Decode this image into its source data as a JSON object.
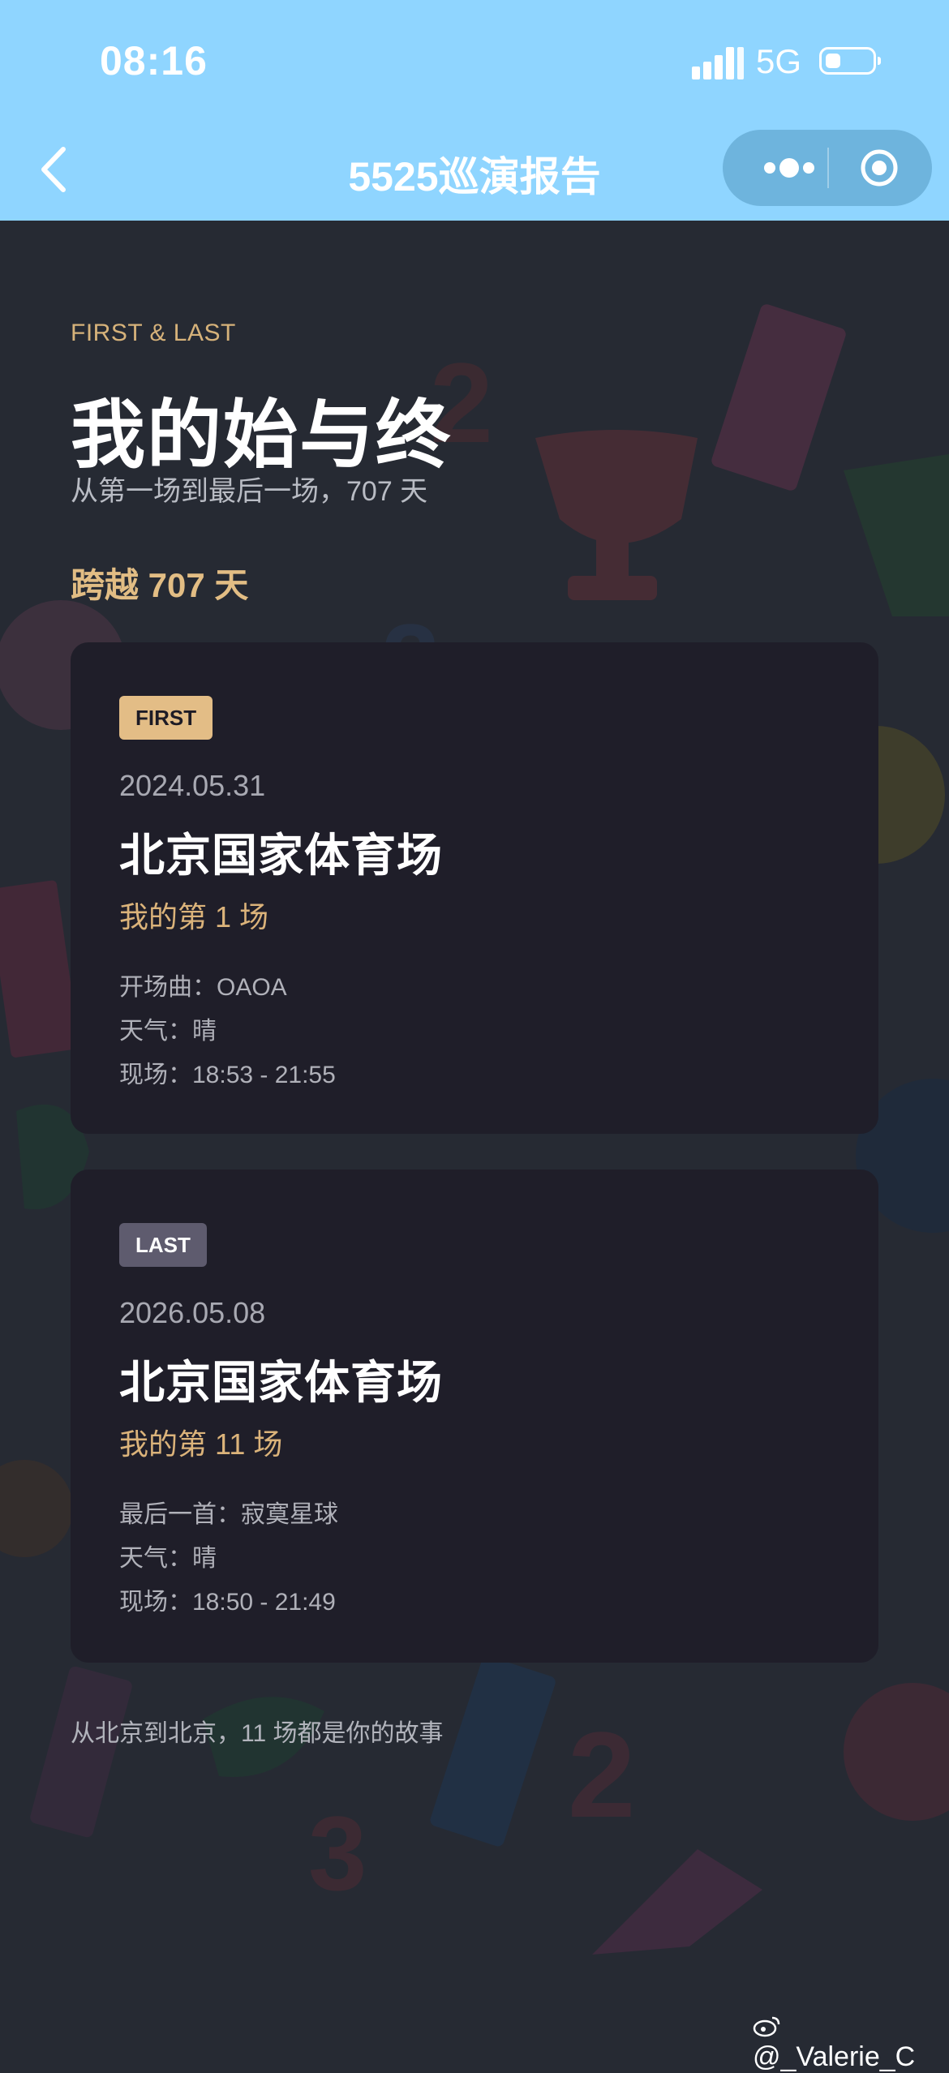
{
  "status_bar": {
    "time": "08:16",
    "network": "5G"
  },
  "nav": {
    "title": "5525巡演报告"
  },
  "report": {
    "eyebrow": "FIRST & LAST",
    "heading": "我的始与终",
    "subheading": "从第一场到最后一场，707 天",
    "span": "跨越 707 天"
  },
  "first_card": {
    "badge": "FIRST",
    "date": "2024.05.31",
    "venue": "北京国家体育场",
    "count": "我的第 1 场",
    "details": [
      "开场曲：OAOA",
      "天气：晴",
      "现场：18:53 - 21:55"
    ]
  },
  "last_card": {
    "badge": "LAST",
    "date": "2026.05.08",
    "venue": "北京国家体育场",
    "count": "我的第 11 场",
    "details": [
      "最后一首：寂寞星球",
      "天气：晴",
      "现场：18:50 - 21:49"
    ]
  },
  "footer": "从北京到北京，11 场都是你的故事",
  "watermark": "@_Valerie_C",
  "colors": {
    "nav_bg": "#8fd5ff",
    "page_bg": "#262a33",
    "card_bg": "#1f1e29",
    "accent_gold": "#e2bd84",
    "badge_last": "#5e5b6e"
  }
}
